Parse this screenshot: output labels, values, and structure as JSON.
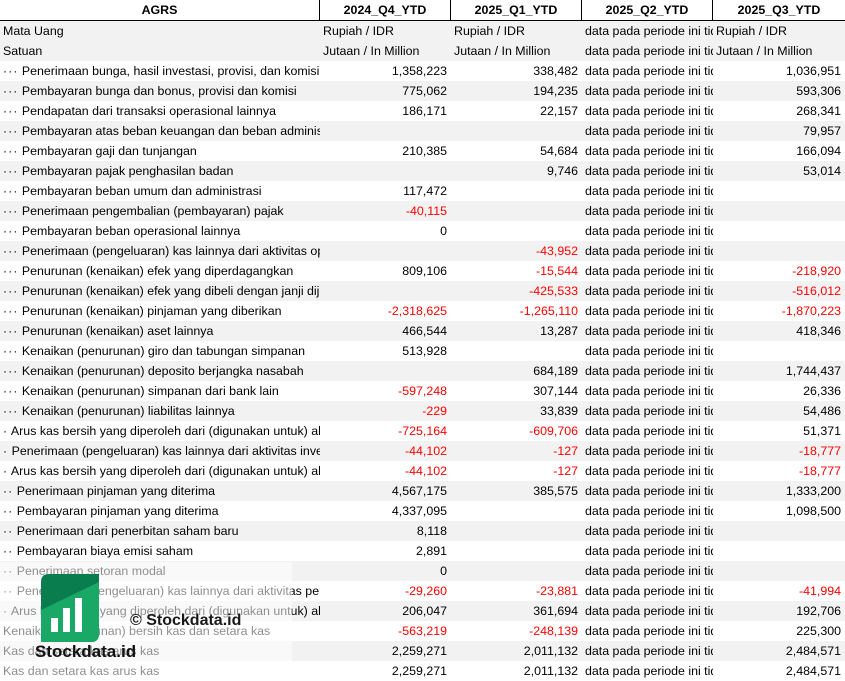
{
  "header": [
    "AGRS",
    "2024_Q4_YTD",
    "2025_Q1_YTD",
    "2025_Q2_YTD",
    "2025_Q3_YTD"
  ],
  "meta_rows": [
    [
      "Mata Uang",
      "Rupiah / IDR",
      "Rupiah / IDR",
      "data pada periode ini tidak tersedia",
      "Rupiah / IDR"
    ],
    [
      "Satuan",
      "Jutaan / In Million",
      "Jutaan / In Million",
      "data pada periode ini tidak tersedia",
      "Jutaan / In Million"
    ]
  ],
  "rows": [
    [
      "···",
      "Penerimaan bunga, hasil investasi, provisi, dan komisi",
      "1,358,223",
      "338,482",
      "data pada periode ini tidak tersedia",
      "1,036,951"
    ],
    [
      "···",
      "Pembayaran bunga dan bonus, provisi dan komisi",
      "775,062",
      "194,235",
      "data pada periode ini tidak tersedia",
      "593,306"
    ],
    [
      "···",
      "Pendapatan dari transaksi operasional lainnya",
      "186,171",
      "22,157",
      "data pada periode ini tidak tersedia",
      "268,341"
    ],
    [
      "···",
      "Pembayaran atas beban keuangan dan beban administrasi bank",
      "",
      "",
      "data pada periode ini tidak tersedia",
      "79,957"
    ],
    [
      "···",
      "Pembayaran gaji dan tunjangan",
      "210,385",
      "54,684",
      "data pada periode ini tidak tersedia",
      "166,094"
    ],
    [
      "···",
      "Pembayaran pajak penghasilan badan",
      "",
      "9,746",
      "data pada periode ini tidak tersedia",
      "53,014"
    ],
    [
      "···",
      "Pembayaran beban umum dan administrasi",
      "117,472",
      "",
      "data pada periode ini tidak tersedia",
      ""
    ],
    [
      "···",
      "Penerimaan pengembalian (pembayaran) pajak",
      "-40,115",
      "",
      "data pada periode ini tidak tersedia",
      ""
    ],
    [
      "···",
      "Pembayaran beban operasional lainnya",
      "0",
      "",
      "data pada periode ini tidak tersedia",
      ""
    ],
    [
      "···",
      "Penerimaan (pengeluaran) kas lainnya dari aktivitas operasi",
      "",
      "-43,952",
      "data pada periode ini tidak tersedia",
      ""
    ],
    [
      "···",
      "Penurunan (kenaikan) efek yang diperdagangkan",
      "809,106",
      "-15,544",
      "data pada periode ini tidak tersedia",
      "-218,920"
    ],
    [
      "···",
      "Penurunan (kenaikan) efek yang dibeli dengan janji dijual kembali",
      "",
      "-425,533",
      "data pada periode ini tidak tersedia",
      "-516,012"
    ],
    [
      "···",
      "Penurunan (kenaikan) pinjaman yang diberikan",
      "-2,318,625",
      "-1,265,110",
      "data pada periode ini tidak tersedia",
      "-1,870,223"
    ],
    [
      "···",
      "Penurunan (kenaikan) aset lainnya",
      "466,544",
      "13,287",
      "data pada periode ini tidak tersedia",
      "418,346"
    ],
    [
      "···",
      "Kenaikan (penurunan) giro dan tabungan simpanan",
      "513,928",
      "",
      "data pada periode ini tidak tersedia",
      ""
    ],
    [
      "···",
      "Kenaikan (penurunan) deposito berjangka nasabah",
      "",
      "684,189",
      "data pada periode ini tidak tersedia",
      "1,744,437"
    ],
    [
      "···",
      "Kenaikan (penurunan) simpanan dari bank lain",
      "-597,248",
      "307,144",
      "data pada periode ini tidak tersedia",
      "26,336"
    ],
    [
      "···",
      "Kenaikan (penurunan) liabilitas lainnya",
      "-229",
      "33,839",
      "data pada periode ini tidak tersedia",
      "54,486"
    ],
    [
      "·",
      "Arus kas bersih yang diperoleh dari (digunakan untuk) aktivitas operasi",
      "-725,164",
      "-609,706",
      "data pada periode ini tidak tersedia",
      "51,371"
    ],
    [
      "·",
      "Penerimaan (pengeluaran) kas lainnya dari aktivitas investasi",
      "-44,102",
      "-127",
      "data pada periode ini tidak tersedia",
      "-18,777"
    ],
    [
      "·",
      "Arus kas bersih yang diperoleh dari (digunakan untuk) aktivitas investasi",
      "-44,102",
      "-127",
      "data pada periode ini tidak tersedia",
      "-18,777"
    ],
    [
      "··",
      "Penerimaan pinjaman yang diterima",
      "4,567,175",
      "385,575",
      "data pada periode ini tidak tersedia",
      "1,333,200"
    ],
    [
      "··",
      "Pembayaran pinjaman yang diterima",
      "4,337,095",
      "",
      "data pada periode ini tidak tersedia",
      "1,098,500"
    ],
    [
      "··",
      "Penerimaan dari penerbitan saham baru",
      "8,118",
      "",
      "data pada periode ini tidak tersedia",
      ""
    ],
    [
      "··",
      "Pembayaran biaya emisi saham",
      "2,891",
      "",
      "data pada periode ini tidak tersedia",
      ""
    ],
    [
      "··",
      "Penerimaan setoran modal",
      "0",
      "",
      "data pada periode ini tidak tersedia",
      ""
    ],
    [
      "··",
      "Penerimaan (pengeluaran) kas lainnya dari aktivitas pendanaan",
      "-29,260",
      "-23,881",
      "data pada periode ini tidak tersedia",
      "-41,994"
    ],
    [
      "·",
      "Arus kas bersih yang diperoleh dari (digunakan untuk) aktivitas pendanaan",
      "206,047",
      "361,694",
      "data pada periode ini tidak tersedia",
      "192,706"
    ],
    [
      "",
      "Kenaikan (penurunan) bersih kas dan setara kas",
      "-563,219",
      "-248,139",
      "data pada periode ini tidak tersedia",
      "225,300"
    ],
    [
      "",
      "Kas dan setara kas arus kas",
      "2,259,271",
      "2,011,132",
      "data pada periode ini tidak tersedia",
      "2,484,571"
    ],
    [
      "",
      "Kas dan setara kas arus kas",
      "2,259,271",
      "2,011,132",
      "data pada periode ini tidak tersedia",
      "2,484,571"
    ]
  ],
  "watermark": {
    "copyright": "© Stockdata.id",
    "brand": "Stockdata.id",
    "logo_icon": "bar-chart-logo-icon",
    "logo_colors": [
      "#0a7d4f",
      "#1aa866",
      "#ffffff"
    ]
  },
  "colors": {
    "negative": "#ff0000",
    "alt_row": "#f2f2f2"
  }
}
